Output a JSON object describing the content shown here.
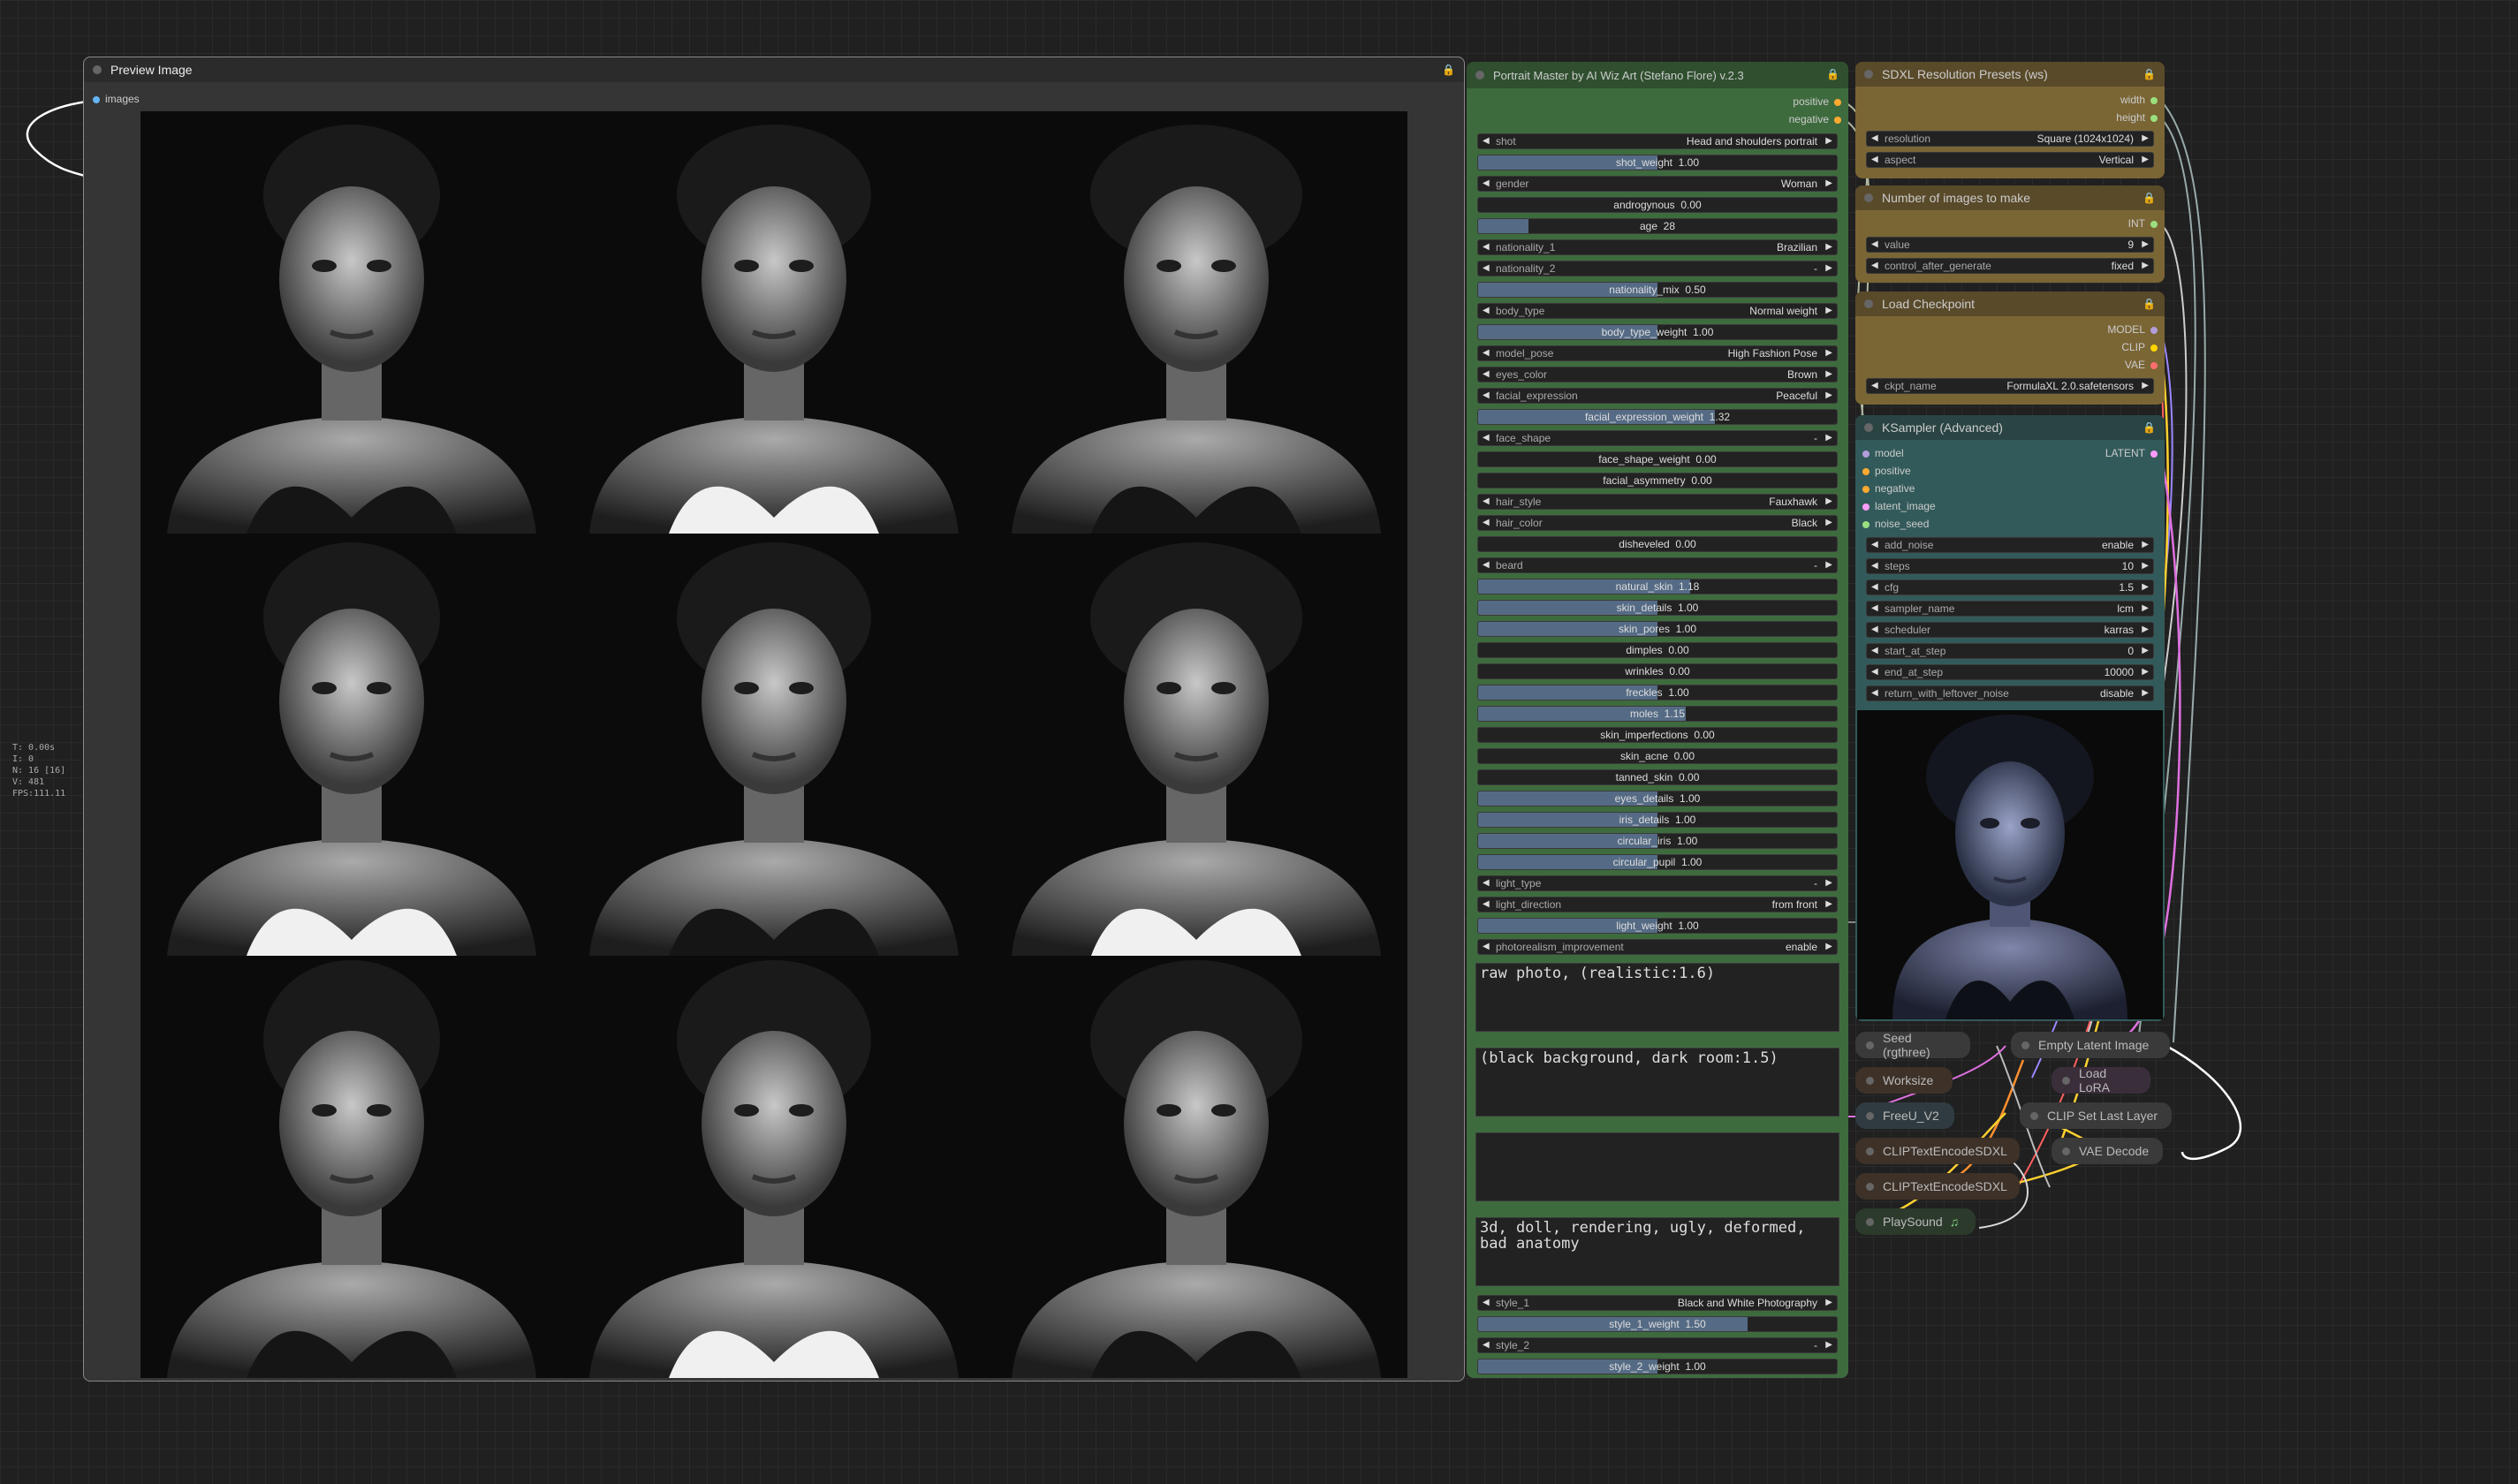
{
  "stats": [
    "T: 0.00s",
    "I: 0",
    "N: 16 [16]",
    "V: 481",
    "FPS:111.11"
  ],
  "preview": {
    "title": "Preview Image",
    "input_label": "images"
  },
  "portrait": {
    "title": "Portrait Master by AI Wiz Art (Stefano Flore) v.2.3",
    "outputs": [
      "positive",
      "negative"
    ],
    "widgets": [
      {
        "kind": "combo",
        "label": "shot",
        "value": "Head and shoulders portrait"
      },
      {
        "kind": "slider",
        "text": "shot_weight  1.00",
        "fraction": 0.5
      },
      {
        "kind": "combo",
        "label": "gender",
        "value": "Woman"
      },
      {
        "kind": "slider",
        "text": "androgynous  0.00",
        "fraction": 0
      },
      {
        "kind": "slider",
        "text": "age  28",
        "fraction": 0.14
      },
      {
        "kind": "combo",
        "label": "nationality_1",
        "value": "Brazilian"
      },
      {
        "kind": "combo",
        "label": "nationality_2",
        "value": "-"
      },
      {
        "kind": "slider",
        "text": "nationality_mix  0.50",
        "fraction": 0.5
      },
      {
        "kind": "combo",
        "label": "body_type",
        "value": "Normal weight"
      },
      {
        "kind": "slider",
        "text": "body_type_weight  1.00",
        "fraction": 0.5
      },
      {
        "kind": "combo",
        "label": "model_pose",
        "value": "High Fashion Pose"
      },
      {
        "kind": "combo",
        "label": "eyes_color",
        "value": "Brown"
      },
      {
        "kind": "combo",
        "label": "facial_expression",
        "value": "Peaceful"
      },
      {
        "kind": "slider",
        "text": "facial_expression_weight  1.32",
        "fraction": 0.66
      },
      {
        "kind": "combo",
        "label": "face_shape",
        "value": "-"
      },
      {
        "kind": "slider",
        "text": "face_shape_weight  0.00",
        "fraction": 0
      },
      {
        "kind": "slider",
        "text": "facial_asymmetry  0.00",
        "fraction": 0
      },
      {
        "kind": "combo",
        "label": "hair_style",
        "value": "Fauxhawk"
      },
      {
        "kind": "combo",
        "label": "hair_color",
        "value": "Black"
      },
      {
        "kind": "slider",
        "text": "disheveled  0.00",
        "fraction": 0
      },
      {
        "kind": "combo",
        "label": "beard",
        "value": "-"
      },
      {
        "kind": "slider",
        "text": "natural_skin  1.18",
        "fraction": 0.59
      },
      {
        "kind": "slider",
        "text": "skin_details  1.00",
        "fraction": 0.5
      },
      {
        "kind": "slider",
        "text": "skin_pores  1.00",
        "fraction": 0.5
      },
      {
        "kind": "slider",
        "text": "dimples  0.00",
        "fraction": 0
      },
      {
        "kind": "slider",
        "text": "wrinkles  0.00",
        "fraction": 0
      },
      {
        "kind": "slider",
        "text": "freckles  1.00",
        "fraction": 0.5
      },
      {
        "kind": "slider",
        "text": "moles  1.15",
        "fraction": 0.58
      },
      {
        "kind": "slider",
        "text": "skin_imperfections  0.00",
        "fraction": 0
      },
      {
        "kind": "slider",
        "text": "skin_acne  0.00",
        "fraction": 0
      },
      {
        "kind": "slider",
        "text": "tanned_skin  0.00",
        "fraction": 0
      },
      {
        "kind": "slider",
        "text": "eyes_details  1.00",
        "fraction": 0.5
      },
      {
        "kind": "slider",
        "text": "iris_details  1.00",
        "fraction": 0.5
      },
      {
        "kind": "slider",
        "text": "circular_iris  1.00",
        "fraction": 0.5
      },
      {
        "kind": "slider",
        "text": "circular_pupil  1.00",
        "fraction": 0.5
      },
      {
        "kind": "combo",
        "label": "light_type",
        "value": "-"
      },
      {
        "kind": "combo",
        "label": "light_direction",
        "value": "from front"
      },
      {
        "kind": "slider",
        "text": "light_weight  1.00",
        "fraction": 0.5
      },
      {
        "kind": "combo",
        "label": "photorealism_improvement",
        "value": "enable"
      }
    ],
    "texts": [
      "raw photo, (realistic:1.6)",
      "(black background, dark room:1.5)",
      "",
      "3d, doll, rendering, ugly, deformed, bad anatomy"
    ],
    "bottom_widgets": [
      {
        "kind": "combo",
        "label": "style_1",
        "value": "Black and White Photography"
      },
      {
        "kind": "slider",
        "text": "style_1_weight  1.50",
        "fraction": 0.75
      },
      {
        "kind": "combo",
        "label": "style_2",
        "value": "-"
      },
      {
        "kind": "slider",
        "text": "style_2_weight  1.00",
        "fraction": 0.5
      }
    ]
  },
  "sdxl": {
    "title": "SDXL Resolution Presets (ws)",
    "outputs": [
      "width",
      "height"
    ],
    "widgets": [
      {
        "kind": "combo",
        "label": "resolution",
        "value": "Square (1024x1024)"
      },
      {
        "kind": "combo",
        "label": "aspect",
        "value": "Vertical"
      }
    ]
  },
  "num_images": {
    "title": "Number of images to make",
    "outputs": [
      "INT"
    ],
    "widgets": [
      {
        "kind": "combo",
        "label": "value",
        "value": "9"
      },
      {
        "kind": "combo",
        "label": "control_after_generate",
        "value": "fixed"
      }
    ]
  },
  "checkpoint": {
    "title": "Load Checkpoint",
    "outputs": [
      "MODEL",
      "CLIP",
      "VAE"
    ],
    "widgets": [
      {
        "kind": "combo",
        "label": "ckpt_name",
        "value": "FormulaXL 2.0.safetensors"
      }
    ]
  },
  "ksampler": {
    "title": "KSampler (Advanced)",
    "inputs": [
      "model",
      "positive",
      "negative",
      "latent_image",
      "noise_seed"
    ],
    "output": "LATENT",
    "widgets": [
      {
        "kind": "combo",
        "label": "add_noise",
        "value": "enable"
      },
      {
        "kind": "combo",
        "label": "steps",
        "value": "10"
      },
      {
        "kind": "combo",
        "label": "cfg",
        "value": "1.5"
      },
      {
        "kind": "combo",
        "label": "sampler_name",
        "value": "lcm"
      },
      {
        "kind": "combo",
        "label": "scheduler",
        "value": "karras"
      },
      {
        "kind": "combo",
        "label": "start_at_step",
        "value": "0"
      },
      {
        "kind": "combo",
        "label": "end_at_step",
        "value": "10000"
      },
      {
        "kind": "combo",
        "label": "return_with_leftover_noise",
        "value": "disable"
      }
    ]
  },
  "collapsed": {
    "seed": "Seed (rgthree)",
    "empty_latent": "Empty Latent Image",
    "worksize": "Worksize",
    "load_lora": "Load LoRA",
    "freeu": "FreeU_V2",
    "clip_set": "CLIP Set Last Layer",
    "clip_enc_1": "CLIPTextEncodeSDXL",
    "vae_decode": "VAE Decode",
    "clip_enc_2": "CLIPTextEncodeSDXL",
    "playsound": "PlaySound"
  },
  "colors": {
    "node_bg": "#353535",
    "green_title": "#2f4f2f",
    "green_body": "#3e6b3e",
    "brown_title": "#594a2a",
    "brown_body": "#7a6535",
    "teal_title": "#2a4444",
    "teal_body": "#335a5a",
    "slider_fill": "#556b85"
  }
}
